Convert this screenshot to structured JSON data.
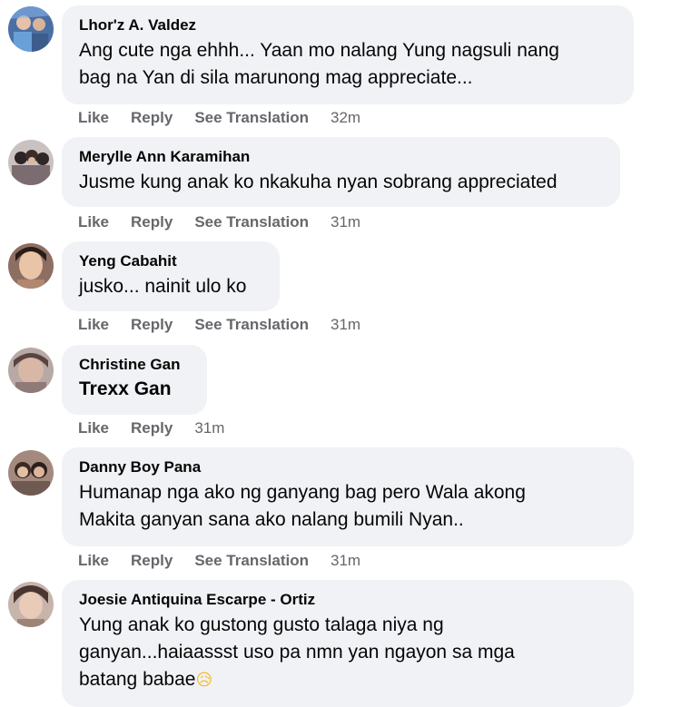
{
  "comments": [
    {
      "author": "Lhor'z A. Valdez",
      "text_lines": [
        "Ang cute nga ehhh... Yaan mo nalang Yung nagsuli nang",
        "bag na Yan di sila marunong mag appreciate..."
      ],
      "actions": {
        "like": "Like",
        "reply": "Reply",
        "translate": "See Translation"
      },
      "time": "32m",
      "avatar_icon": "profile-photo"
    },
    {
      "author": "Merylle Ann Karamihan",
      "text_lines": [
        "Jusme kung anak ko nkakuha nyan sobrang appreciated"
      ],
      "actions": {
        "like": "Like",
        "reply": "Reply",
        "translate": "See Translation"
      },
      "time": "31m",
      "avatar_icon": "profile-photo"
    },
    {
      "author": "Yeng Cabahit",
      "text_lines": [
        "jusko... nainit ulo ko"
      ],
      "actions": {
        "like": "Like",
        "reply": "Reply",
        "translate": "See Translation"
      },
      "time": "31m",
      "avatar_icon": "profile-photo"
    },
    {
      "author": "Christine Gan",
      "text_lines": [
        "Trexx Gan"
      ],
      "actions": {
        "like": "Like",
        "reply": "Reply"
      },
      "time": "31m",
      "avatar_icon": "profile-photo"
    },
    {
      "author": "Danny Boy Pana",
      "text_lines": [
        "Humanap nga ako ng ganyang bag pero Wala akong",
        "Makita ganyan sana ako nalang bumili Nyan.."
      ],
      "actions": {
        "like": "Like",
        "reply": "Reply",
        "translate": "See Translation"
      },
      "time": "31m",
      "avatar_icon": "profile-photo"
    },
    {
      "author": "Joesie Antiquina Escarpe - Ortiz",
      "text_lines": [
        "Yung anak ko gustong gusto talaga niya ng",
        "ganyan...haiaassst uso pa nmn yan ngayon sa mga",
        "batang babae"
      ],
      "emoji": "😥",
      "emoji_icon": "sad-relieved-face-emoji",
      "avatar_icon": "profile-photo"
    }
  ],
  "colors": {
    "bubble": "#f0f2f5",
    "author": "#050505",
    "text": "#050505",
    "actions": "#65676b"
  }
}
